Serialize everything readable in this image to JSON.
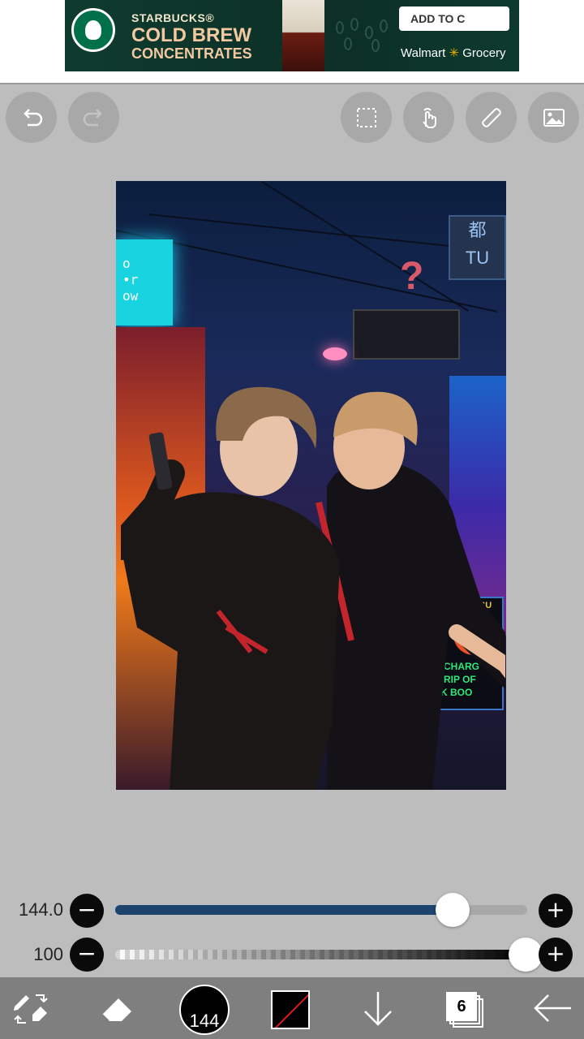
{
  "ad": {
    "brand": "STARBUCKS®",
    "headline_1": "COLD BREW",
    "headline_2": "CONCENTRATES",
    "cta": "ADD TO C",
    "retailer": "Walmart",
    "retailer_section": "Grocery",
    "colors": {
      "background": "#0f3b2f",
      "headline": "#f2c9a0",
      "close": "#00aecd"
    }
  },
  "toolbar": {
    "icons": [
      "undo-icon",
      "redo-icon",
      "selection-icon",
      "hand-tool-icon",
      "ruler-icon",
      "image-icon"
    ]
  },
  "canvas": {
    "sign_text": "o\n•r\now",
    "question_sign": "?",
    "right_sign": "都\nTU",
    "alley_sign": "ALLEY★SU",
    "green_sign": "-CHARG\n-RIP OF\nK BOO"
  },
  "sliders": {
    "size": {
      "value_label": "144.0",
      "fraction": 0.82
    },
    "opacity": {
      "value_label": "100",
      "fraction": 1.0
    },
    "accent": "#1c446e"
  },
  "bottom_bar": {
    "brush_size": "144",
    "layer_count": "6",
    "current_color": "#000000",
    "icons": [
      "tool-switch-icon",
      "eraser-icon",
      "brush-size-icon",
      "color-swatch-icon",
      "arrow-down-icon",
      "layers-icon",
      "back-arrow-icon"
    ]
  }
}
